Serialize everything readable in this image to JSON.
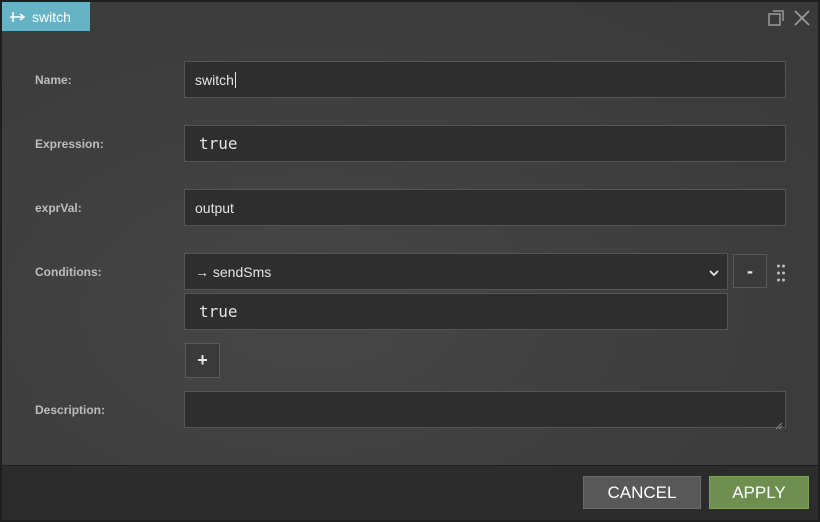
{
  "window": {
    "title": "switch",
    "title_icon": "switch-node-icon",
    "controls": [
      "maximize-icon",
      "close-icon"
    ],
    "tab_color": "#66b3c6"
  },
  "form": {
    "name": {
      "label": "Name:",
      "value": "switch"
    },
    "expression": {
      "label": "Expression:",
      "value": "true"
    },
    "exprVal": {
      "label": "exprVal:",
      "value": "output"
    },
    "conditions": {
      "label": "Conditions:",
      "items": [
        {
          "target": "→ sendSms",
          "expression": "true",
          "remove_label": "-"
        }
      ],
      "add_label": "+"
    },
    "description": {
      "label": "Description:",
      "value": ""
    }
  },
  "footer": {
    "cancel_label": "CANCEL",
    "apply_label": "APPLY",
    "apply_color": "#6e8f4f"
  }
}
